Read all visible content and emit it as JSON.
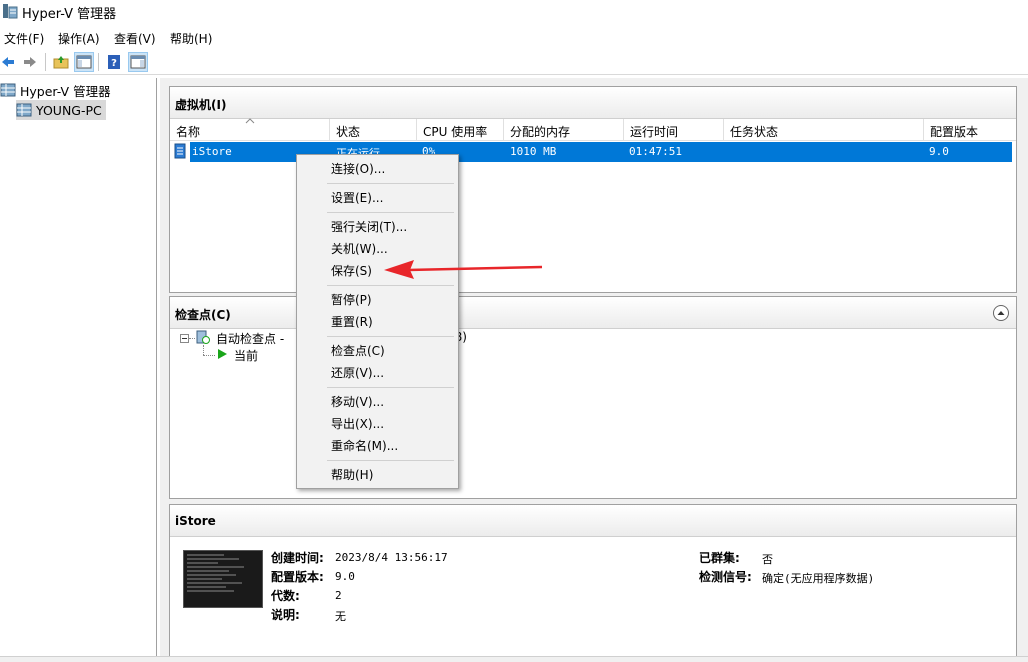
{
  "window": {
    "title": "Hyper-V 管理器"
  },
  "menu": [
    "文件(F)",
    "操作(A)",
    "查看(V)",
    "帮助(H)"
  ],
  "toolbar": {
    "icons": [
      "back-arrow-icon",
      "forward-arrow-icon",
      "folder-up-icon",
      "console-tree-icon",
      "help-icon",
      "action-pane-icon"
    ]
  },
  "tree": {
    "root": "Hyper-V 管理器",
    "host": "YOUNG-PC"
  },
  "vm_panel": {
    "title": "虚拟机(I)",
    "columns": [
      "名称",
      "状态",
      "CPU 使用率",
      "分配的内存",
      "运行时间",
      "任务状态",
      "配置版本"
    ],
    "row": {
      "name": "iStore",
      "state": "正在运行",
      "cpu": "0%",
      "memory": "1010 MB",
      "uptime": "01:47:51",
      "task": "",
      "version": "9.0"
    }
  },
  "checkpoint_panel": {
    "title": "检查点(C)",
    "node_prefix": "自动检查点 -",
    "node_suffix": "38)",
    "current": "当前"
  },
  "details_panel": {
    "title": "iStore",
    "created_label": "创建时间:",
    "created_value": "2023/8/4 13:56:17",
    "version_label": "配置版本:",
    "version_value": "9.0",
    "generation_label": "代数:",
    "generation_value": "2",
    "notes_label": "说明:",
    "notes_value": "无",
    "clustered_label": "已群集:",
    "clustered_value": "否",
    "heartbeat_label": "检测信号:",
    "heartbeat_value": "确定(无应用程序数据)"
  },
  "context_menu": {
    "items": [
      "连接(O)...",
      "设置(E)...",
      "强行关闭(T)...",
      "关机(W)...",
      "保存(S)",
      "暂停(P)",
      "重置(R)",
      "检查点(C)",
      "还原(V)...",
      "移动(V)...",
      "导出(X)...",
      "重命名(M)...",
      "帮助(H)"
    ]
  },
  "colors": {
    "selection": "#0078d7",
    "annotation_arrow": "#e8262a",
    "running_green": "#1aa51a"
  }
}
